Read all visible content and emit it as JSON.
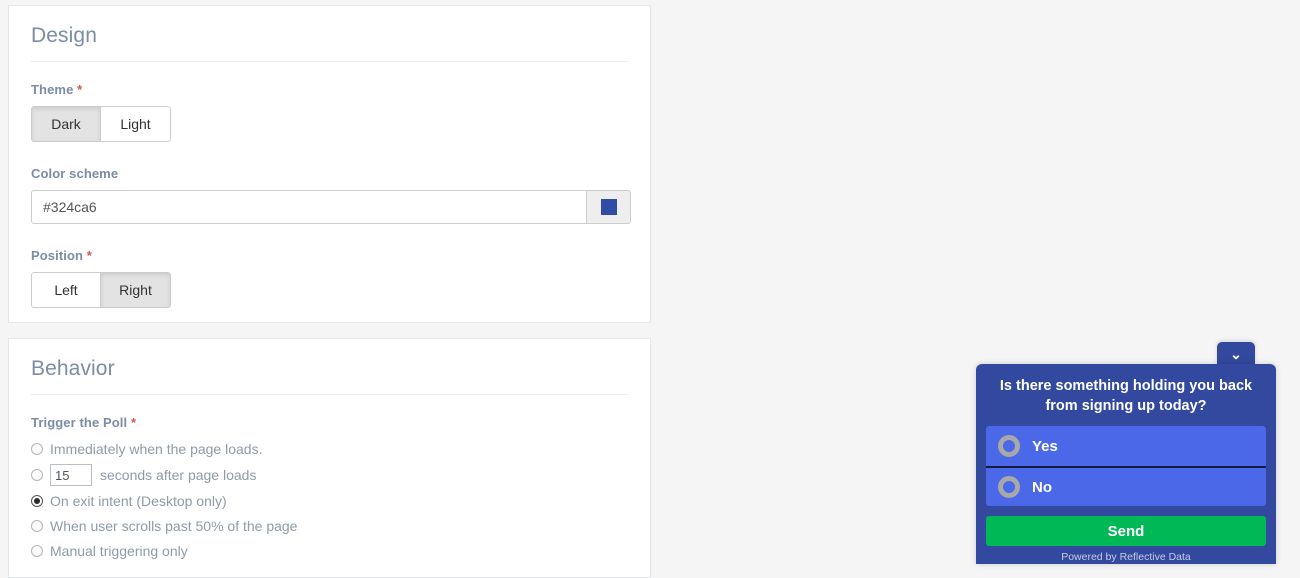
{
  "page": {
    "background_color": "#f5f5f6"
  },
  "design_card": {
    "title": "Design",
    "theme": {
      "label": "Theme",
      "required_marker": "*",
      "options": [
        {
          "label": "Dark",
          "active": true
        },
        {
          "label": "Light",
          "active": false
        }
      ]
    },
    "color_scheme": {
      "label": "Color scheme",
      "value": "#324ca6",
      "placeholder": "#324ca6",
      "swatch_color": "#324ca6"
    },
    "position": {
      "label": "Position",
      "required_marker": "*",
      "options": [
        {
          "label": "Left",
          "active": false
        },
        {
          "label": "Right",
          "active": true
        }
      ]
    }
  },
  "behavior_card": {
    "title": "Behavior",
    "trigger": {
      "label": "Trigger the Poll",
      "required_marker": "*",
      "options": [
        {
          "label": "Immediately when the page loads.",
          "checked": false
        },
        {
          "label_before": "",
          "input_value": "15",
          "label": "seconds after page loads",
          "checked": false,
          "has_input": true
        },
        {
          "label": "On exit intent (Desktop only)",
          "checked": true
        },
        {
          "label": "When user scrolls past 50% of the page",
          "checked": false
        },
        {
          "label": "Manual triggering only",
          "checked": false
        }
      ]
    }
  },
  "poll_widget": {
    "collapse_icon": "⌄",
    "question": "Is there something holding you back from signing up today?",
    "options": [
      {
        "label": "Yes",
        "selected": false
      },
      {
        "label": "No",
        "selected": false
      }
    ],
    "send_label": "Send",
    "footer": "Powered by Reflective Data",
    "colors": {
      "panel": "#32499f",
      "option": "#4a68e8",
      "send": "#00b956"
    }
  }
}
